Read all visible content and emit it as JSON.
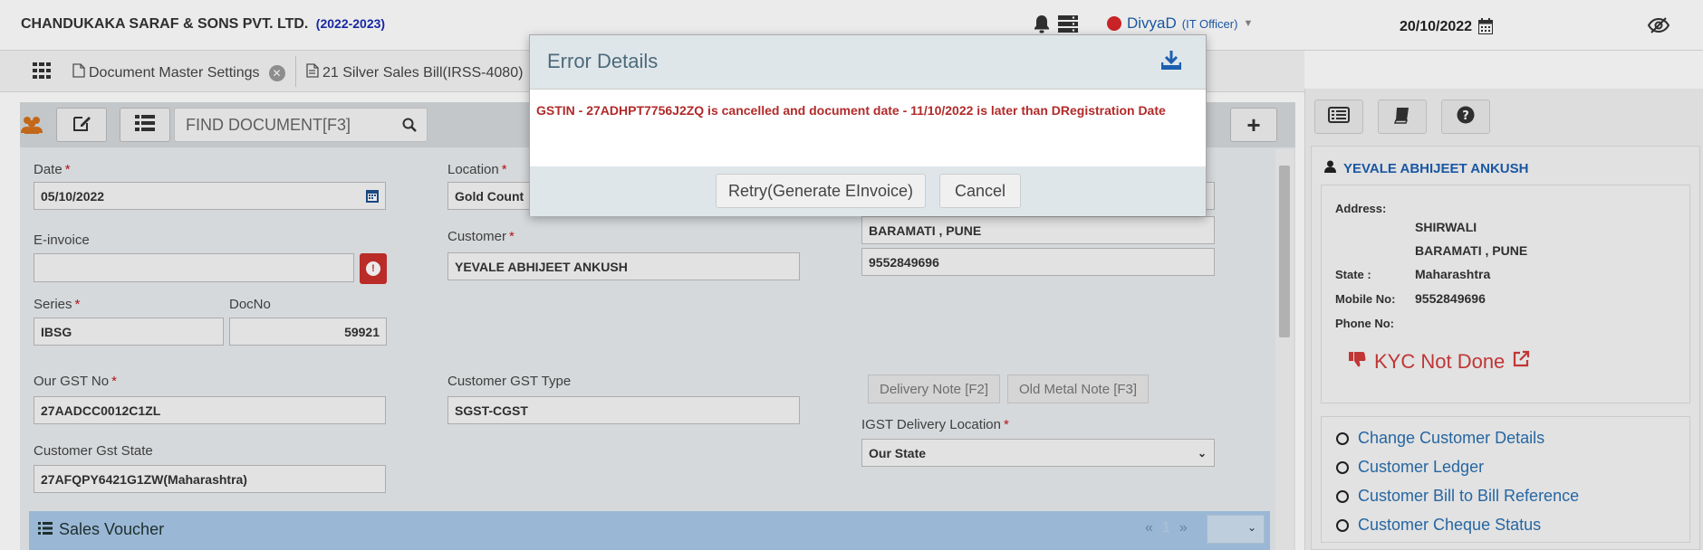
{
  "header": {
    "company": "CHANDUKAKA SARAF & SONS PVT. LTD.",
    "year": "(2022-2023)",
    "user_name": "DivyaD",
    "user_role": "(IT Officer)",
    "date": "20/10/2022"
  },
  "tabs": [
    {
      "label": "Document Master Settings"
    },
    {
      "label": "21 Silver Sales Bill(IRSS-4080)"
    }
  ],
  "toolbar": {
    "find_placeholder": "FIND DOCUMENT[F3]",
    "plus_label": "+"
  },
  "form": {
    "date_label": "Date",
    "date_value": "05/10/2022",
    "location_label": "Location",
    "location_value": "Gold Count",
    "einvoice_label": "E-invoice",
    "einvoice_value": "",
    "customer_label": "Customer",
    "customer_value": "YEVALE ABHIJEET ANKUSH",
    "address_line2": "BARAMATI , PUNE",
    "phone": "9552849696",
    "series_label": "Series",
    "series_value": "IBSG",
    "docno_label": "DocNo",
    "docno_value": "59921",
    "our_gst_label": "Our GST No",
    "our_gst_value": "27AADCC0012C1ZL",
    "cust_gst_type_label": "Customer GST Type",
    "cust_gst_type_value": "SGST-CGST",
    "delivery_note_label": "Delivery Note [F2]",
    "old_metal_note_label": "Old Metal Note [F3]",
    "igst_label": "IGST Delivery Location",
    "igst_value": "Our State",
    "cust_gst_state_label": "Customer Gst State",
    "cust_gst_state_value": "27AFQPY6421G1ZW(Maharashtra)"
  },
  "voucher": {
    "title": "Sales Voucher",
    "prev": "«",
    "page": "1",
    "next": "»"
  },
  "customer_panel": {
    "name": "YEVALE ABHIJEET ANKUSH",
    "address_key": "Address:",
    "address_line1": "SHIRWALI",
    "address_line2": "BARAMATI , PUNE",
    "state_key": "State :",
    "state_value": "Maharashtra",
    "mobile_key": "Mobile No:",
    "mobile_value": "9552849696",
    "phone_key": "Phone No:",
    "phone_value": "",
    "kyc": "KYC Not Done",
    "links": [
      {
        "label": "Change Customer Details"
      },
      {
        "label": "Customer Ledger"
      },
      {
        "label": "Customer Bill to Bill Reference"
      },
      {
        "label": "Customer Cheque Status"
      }
    ]
  },
  "modal": {
    "title": "Error Details",
    "message": "GSTIN - 27ADHPT7756J2ZQ is cancelled and document date - 11/10/2022 is later than DRegistration Date",
    "retry_label": "Retry(Generate EInvoice)",
    "cancel_label": "Cancel"
  },
  "colors": {
    "accent": "#1d5fb0",
    "error": "#b22a2a",
    "voucher_bar": "#a8c8e8"
  }
}
